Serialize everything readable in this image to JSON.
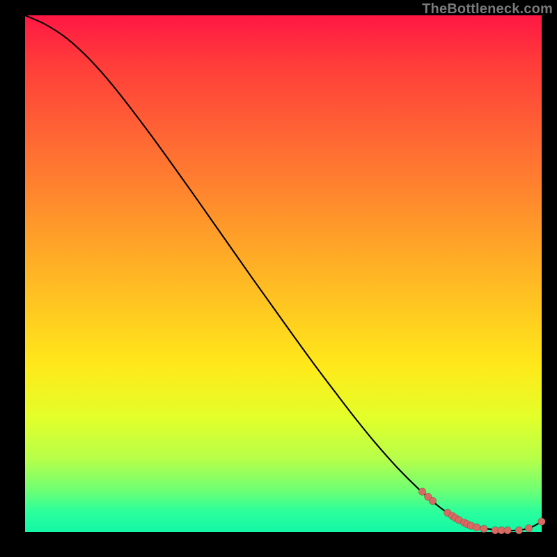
{
  "watermark": "TheBottleneck.com",
  "chart_data": {
    "type": "line",
    "title": "",
    "xlabel": "",
    "ylabel": "",
    "xlim": [
      0,
      100
    ],
    "ylim": [
      0,
      100
    ],
    "grid": false,
    "legend": false,
    "series": [
      {
        "name": "curve",
        "x": [
          0,
          4,
          8,
          12,
          16,
          20,
          24,
          28,
          32,
          36,
          40,
          44,
          48,
          52,
          56,
          60,
          64,
          68,
          72,
          76,
          80,
          83,
          86,
          89,
          92,
          95,
          97.5,
          100
        ],
        "y": [
          100.0,
          98.2,
          95.6,
          92.0,
          87.6,
          82.6,
          77.3,
          71.8,
          66.2,
          60.5,
          54.8,
          49.1,
          43.5,
          37.9,
          32.4,
          27.1,
          21.9,
          17.0,
          12.5,
          8.5,
          5.0,
          2.9,
          1.5,
          0.7,
          0.3,
          0.3,
          0.7,
          2.0
        ]
      }
    ],
    "markers": {
      "name": "highlighted-points",
      "x": [
        76.9,
        78.0,
        78.9,
        81.8,
        82.7,
        83.3,
        84.0,
        85.0,
        85.6,
        86.3,
        87.4,
        88.8,
        91.0,
        92.2,
        93.4,
        95.6,
        97.5,
        100.0
      ],
      "y": [
        7.8,
        6.8,
        6.0,
        3.7,
        3.1,
        2.7,
        2.3,
        1.8,
        1.5,
        1.2,
        0.9,
        0.6,
        0.3,
        0.3,
        0.3,
        0.3,
        0.7,
        2.0
      ]
    }
  }
}
